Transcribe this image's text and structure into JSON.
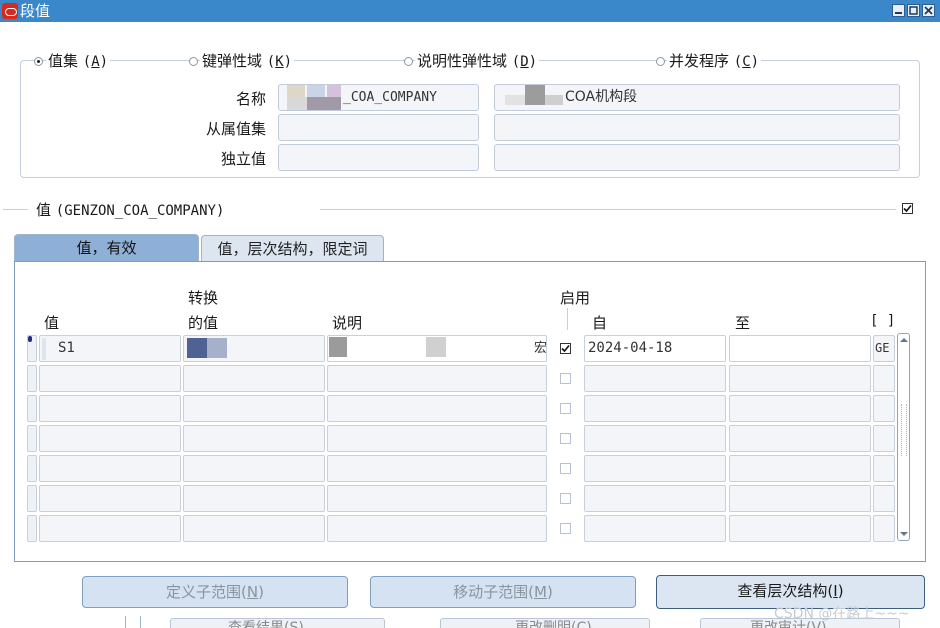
{
  "window": {
    "title": "段值"
  },
  "radios": [
    {
      "label": "值集",
      "key": "(A)",
      "key_letter": "A",
      "selected": true
    },
    {
      "label": "键弹性域",
      "key": "(K)",
      "key_letter": "K",
      "selected": false
    },
    {
      "label": "说明性弹性域",
      "key": "(D)",
      "key_letter": "D",
      "selected": false
    },
    {
      "label": "并发程序",
      "key": "(C)",
      "key_letter": "C",
      "selected": false
    }
  ],
  "fields": {
    "name_label": "名称",
    "name_value": "_COA_COMPANY",
    "name_desc": "COA机构段",
    "dependent_label": "从属值集",
    "independent_label": "独立值"
  },
  "values_section": {
    "title": "值",
    "set_name": "(GENZON_COA_COMPANY)"
  },
  "tabs": [
    {
      "label": "值，有效",
      "active": true
    },
    {
      "label": "值，层次结构，限定词",
      "active": false
    }
  ],
  "table": {
    "headers": {
      "value": "值",
      "translated_1": "转换",
      "translated_2": "的值",
      "description": "说明",
      "enabled": "启用",
      "from": "自",
      "to": "至",
      "extra": "[ ]"
    },
    "rows": [
      {
        "value": "S1",
        "description_tail": "宏",
        "enabled": true,
        "from": "2024-04-18",
        "to": "",
        "extra": "GE"
      },
      {
        "value": "",
        "description_tail": "",
        "enabled": false,
        "from": "",
        "to": "",
        "extra": ""
      },
      {
        "value": "",
        "description_tail": "",
        "enabled": false,
        "from": "",
        "to": "",
        "extra": ""
      },
      {
        "value": "",
        "description_tail": "",
        "enabled": false,
        "from": "",
        "to": "",
        "extra": ""
      },
      {
        "value": "",
        "description_tail": "",
        "enabled": false,
        "from": "",
        "to": "",
        "extra": ""
      },
      {
        "value": "",
        "description_tail": "",
        "enabled": false,
        "from": "",
        "to": "",
        "extra": ""
      },
      {
        "value": "",
        "description_tail": "",
        "enabled": false,
        "from": "",
        "to": "",
        "extra": ""
      }
    ]
  },
  "buttons": [
    {
      "label": "定义子范围",
      "key": "(N)",
      "key_letter": "N",
      "enabled": false
    },
    {
      "label": "移动子范围",
      "key": "(M)",
      "key_letter": "M",
      "enabled": false
    },
    {
      "label": "查看层次结构",
      "key": "(I)",
      "key_letter": "I",
      "enabled": true
    }
  ],
  "background_buttons": [
    {
      "label": "查看结果(S)"
    },
    {
      "label": "更改删明(C)"
    },
    {
      "label": "更改审计(V)"
    }
  ],
  "watermark": "CSDN @在路上~~~",
  "colors": {
    "titlebar": "#3a87c9",
    "active_tab": "#8fb0d6",
    "inactive_tab": "#dde6f0",
    "brand_icon": "#d62a1e"
  }
}
